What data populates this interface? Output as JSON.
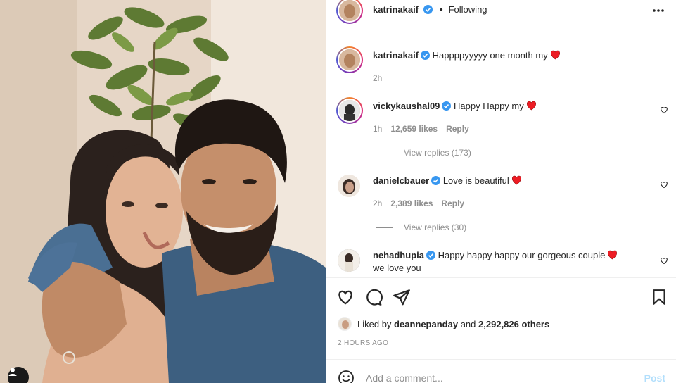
{
  "post": {
    "author": "katrinakaif",
    "follow_status": "Following",
    "caption": "Happppyyyyy one month my",
    "caption_age": "2h"
  },
  "icons": {
    "verified": "verified-badge-icon",
    "more": "more-options-icon",
    "heart": "heart-icon",
    "comment": "comment-icon",
    "share": "share-icon",
    "save": "bookmark-icon",
    "emoji": "emoji-icon",
    "tag": "user-tag-icon"
  },
  "colors": {
    "verified_blue": "#3897f0",
    "heart_red": "#ed1c24",
    "post_button": "#b2dffc",
    "muted_text": "#8e8e8e"
  },
  "comments": [
    {
      "user": "vickykaushal09",
      "text": "Happy Happy my",
      "age": "1h",
      "likes": "12,659 likes",
      "reply": "Reply",
      "replies_label": "View replies (173)"
    },
    {
      "user": "danielcbauer",
      "text": "Love is beautiful",
      "age": "2h",
      "likes": "2,389 likes",
      "reply": "Reply",
      "replies_label": "View replies (30)"
    },
    {
      "user": "nehadhupia",
      "text": "Happy happy happy our gorgeous couple",
      "text_line2": "we love you"
    }
  ],
  "likes_summary": {
    "prefix": "Liked by",
    "user": "deannepanday",
    "connector": "and",
    "count": "2,292,826 others"
  },
  "timestamp": "2 HOURS AGO",
  "add_comment": {
    "placeholder": "Add a comment...",
    "post_label": "Post"
  }
}
